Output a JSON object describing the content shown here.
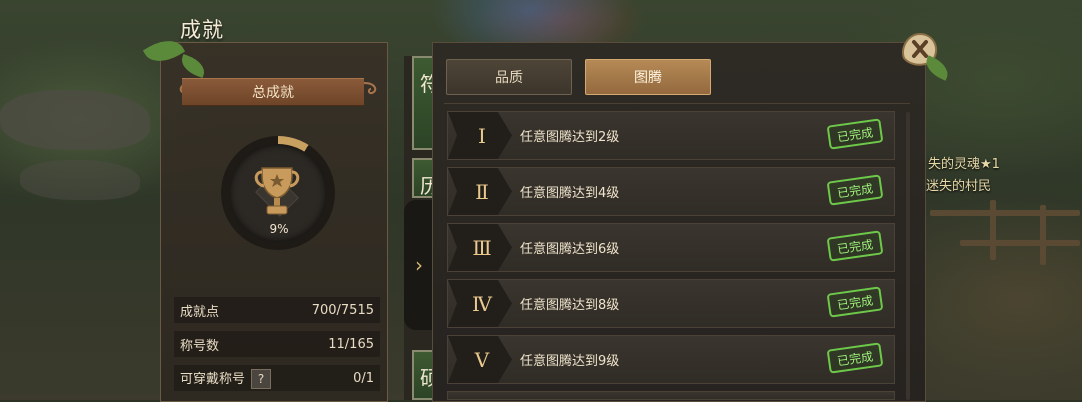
{
  "window": {
    "title": "成就"
  },
  "summary": {
    "banner": "总成就",
    "progress_percent": 9,
    "progress_label": "9%",
    "stats": [
      {
        "label": "成就点",
        "value": "700/7515"
      },
      {
        "label": "称号数",
        "value": "11/165"
      },
      {
        "label": "可穿戴称号",
        "value": "0/1",
        "help": "?"
      }
    ]
  },
  "side_tabs": {
    "visible_chars": [
      "符",
      "历",
      "硕"
    ],
    "toggle_glyph": "›"
  },
  "tabs": [
    {
      "label": "品质",
      "active": false
    },
    {
      "label": "图腾",
      "active": true
    }
  ],
  "achievements": [
    {
      "roman": "Ⅰ",
      "text": "任意图腾达到2级",
      "status": "已完成"
    },
    {
      "roman": "Ⅱ",
      "text": "任意图腾达到4级",
      "status": "已完成"
    },
    {
      "roman": "Ⅲ",
      "text": "任意图腾达到6级",
      "status": "已完成"
    },
    {
      "roman": "Ⅳ",
      "text": "任意图腾达到8级",
      "status": "已完成"
    },
    {
      "roman": "Ⅴ",
      "text": "任意图腾达到9级",
      "status": "已完成"
    }
  ],
  "background_labels": {
    "line1": "失的灵魂★1",
    "line2": "迷失的村民"
  },
  "icons": {
    "trophy": "trophy-icon",
    "close": "close-icon"
  },
  "colors": {
    "accent_gold": "#c8a060",
    "done_green": "#6ec84a",
    "active_tab": "#b58a56"
  }
}
